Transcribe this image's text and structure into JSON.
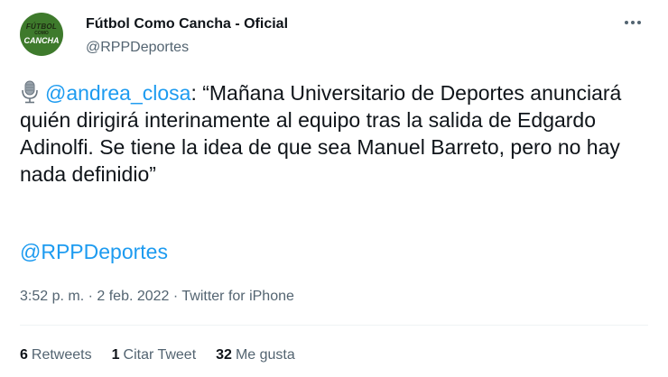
{
  "author": {
    "display_name": "Fútbol Como Cancha - Oficial",
    "handle": "@RPPDeportes",
    "avatar_text": [
      "FÚTBOL",
      "COMO",
      "CANCHA"
    ]
  },
  "tweet": {
    "mic_icon": "microphone-icon",
    "mention": "@andrea_closa",
    "quote": ": “Mañana Universitario de Deportes anunciará quién dirigirá interinamente al equipo tras la salida de Edgardo Adinolfi. Se tiene la idea de que sea Manuel Barreto, pero no hay nada definidio”",
    "link_mention": "@RPPDeportes"
  },
  "meta": {
    "time": "3:52 p. m.",
    "sep1": " · ",
    "date": "2 feb. 2022",
    "sep2": " · ",
    "source": "Twitter for iPhone"
  },
  "stats": {
    "retweets_count": "6",
    "retweets_label": "Retweets",
    "quotes_count": "1",
    "quotes_label": "Citar Tweet",
    "likes_count": "32",
    "likes_label": "Me gusta"
  },
  "colors": {
    "link": "#1d9bf0",
    "text": "#0f1419",
    "secondary": "#536471"
  }
}
